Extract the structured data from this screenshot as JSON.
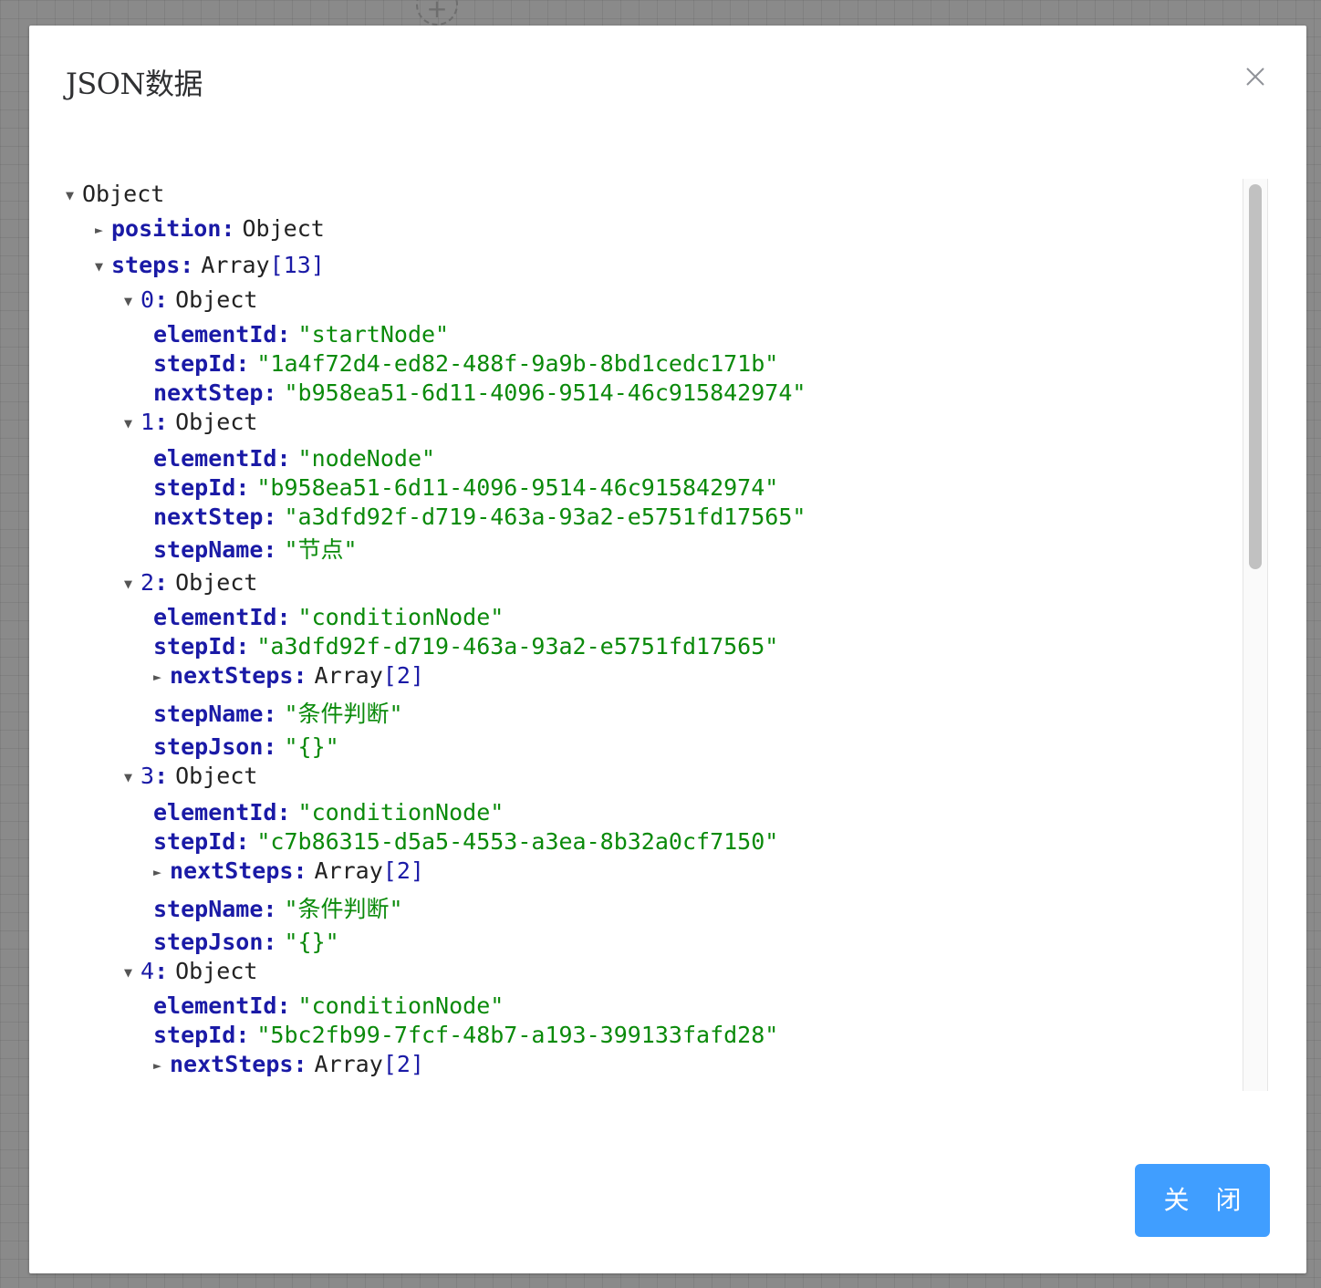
{
  "dialog": {
    "title": "JSON数据",
    "close_button_label": "关 闭",
    "close_icon": "close-icon"
  },
  "background": {
    "add_node_icon": "plus-icon",
    "add_node_symbol": "+"
  },
  "tree": {
    "root_type": "Object",
    "position": {
      "key": "position",
      "type": "Object"
    },
    "steps": {
      "key": "steps",
      "type": "Array",
      "count": "[13]",
      "items": [
        {
          "index": "0",
          "type": "Object",
          "fields": [
            {
              "key": "elementId",
              "value": "\"startNode\""
            },
            {
              "key": "stepId",
              "value": "\"1a4f72d4-ed82-488f-9a9b-8bd1cedc171b\""
            },
            {
              "key": "nextStep",
              "value": "\"b958ea51-6d11-4096-9514-46c915842974\""
            }
          ]
        },
        {
          "index": "1",
          "type": "Object",
          "fields": [
            {
              "key": "elementId",
              "value": "\"nodeNode\""
            },
            {
              "key": "stepId",
              "value": "\"b958ea51-6d11-4096-9514-46c915842974\""
            },
            {
              "key": "nextStep",
              "value": "\"a3dfd92f-d719-463a-93a2-e5751fd17565\""
            },
            {
              "key": "stepName",
              "value": "\"节点\""
            }
          ]
        },
        {
          "index": "2",
          "type": "Object",
          "fields": [
            {
              "key": "elementId",
              "value": "\"conditionNode\""
            },
            {
              "key": "stepId",
              "value": "\"a3dfd92f-d719-463a-93a2-e5751fd17565\""
            },
            {
              "key": "nextSteps",
              "type": "Array",
              "count": "[2]"
            },
            {
              "key": "stepName",
              "value": "\"条件判断\""
            },
            {
              "key": "stepJson",
              "value": "\"{}\""
            }
          ]
        },
        {
          "index": "3",
          "type": "Object",
          "fields": [
            {
              "key": "elementId",
              "value": "\"conditionNode\""
            },
            {
              "key": "stepId",
              "value": "\"c7b86315-d5a5-4553-a3ea-8b32a0cf7150\""
            },
            {
              "key": "nextSteps",
              "type": "Array",
              "count": "[2]"
            },
            {
              "key": "stepName",
              "value": "\"条件判断\""
            },
            {
              "key": "stepJson",
              "value": "\"{}\""
            }
          ]
        },
        {
          "index": "4",
          "type": "Object",
          "fields": [
            {
              "key": "elementId",
              "value": "\"conditionNode\""
            },
            {
              "key": "stepId",
              "value": "\"5bc2fb99-7fcf-48b7-a193-399133fafd28\""
            },
            {
              "key": "nextSteps",
              "type": "Array",
              "count": "[2]"
            }
          ]
        }
      ]
    }
  },
  "colors": {
    "key": "#1a1aa6",
    "string": "#0a8a0a",
    "type": "#222222",
    "button": "#409eff"
  }
}
